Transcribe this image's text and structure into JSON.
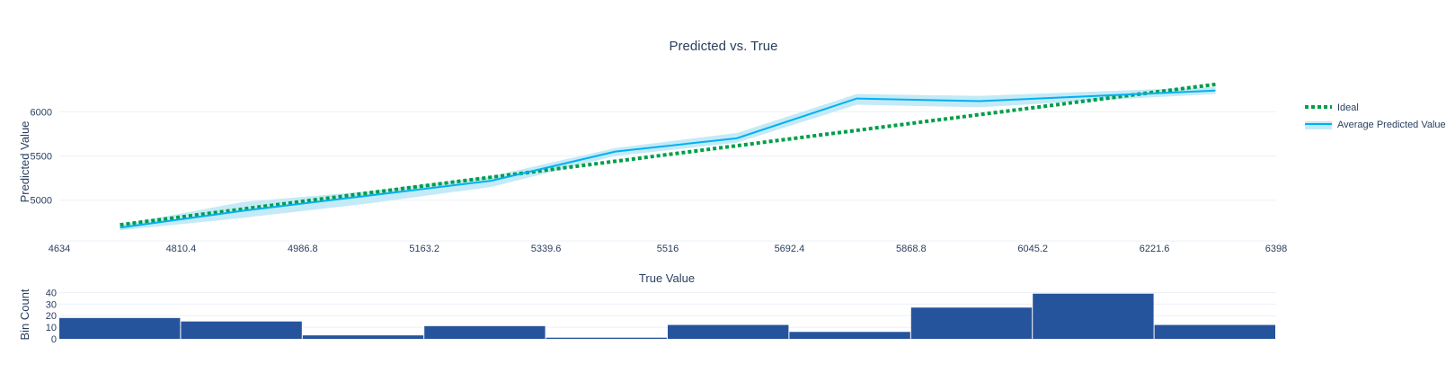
{
  "chart_data": [
    {
      "type": "line",
      "title": "Predicted vs. True",
      "ylabel": "Predicted Value",
      "xlim": [
        4634,
        6398
      ],
      "ylim": [
        4540,
        6400
      ],
      "x_ticks": [
        4634,
        4810.4,
        4986.8,
        5163.2,
        5339.6,
        5516,
        5692.4,
        5868.8,
        6045.2,
        6221.6,
        6398
      ],
      "y_ticks": [
        5000,
        5500,
        6000
      ],
      "legend_position": "right",
      "series": [
        {
          "name": "Ideal",
          "style": "dotted",
          "color": "#009e49",
          "x": [
            4722,
            6310
          ],
          "y": [
            4722,
            6310
          ]
        },
        {
          "name": "Average Predicted Value",
          "style": "solid",
          "color": "#00b0f0",
          "band_color": "#c4eaf7",
          "x": [
            4722,
            4900,
            5080,
            5260,
            5440,
            5616,
            5790,
            5968,
            6140,
            6310
          ],
          "y": [
            4690,
            4880,
            5050,
            5220,
            5550,
            5700,
            6150,
            6120,
            6180,
            6240
          ],
          "lower": [
            4660,
            4800,
            4960,
            5150,
            5500,
            5650,
            6080,
            6050,
            6130,
            6200
          ],
          "upper": [
            4720,
            4980,
            5100,
            5270,
            5590,
            5760,
            6200,
            6180,
            6230,
            6280
          ]
        }
      ]
    },
    {
      "type": "bar",
      "title": "True Value",
      "ylabel": "Bin Count",
      "xlim": [
        4634,
        6398
      ],
      "ylim": [
        0,
        45
      ],
      "y_ticks": [
        0,
        10,
        20,
        30,
        40
      ],
      "color": "#26549c",
      "bins": [
        4634,
        4810.4,
        4986.8,
        5163.2,
        5339.6,
        5516,
        5692.4,
        5868.8,
        6045.2,
        6221.6,
        6398
      ],
      "values": [
        18,
        15,
        3,
        11,
        1,
        12,
        6,
        27,
        39,
        12
      ]
    }
  ]
}
